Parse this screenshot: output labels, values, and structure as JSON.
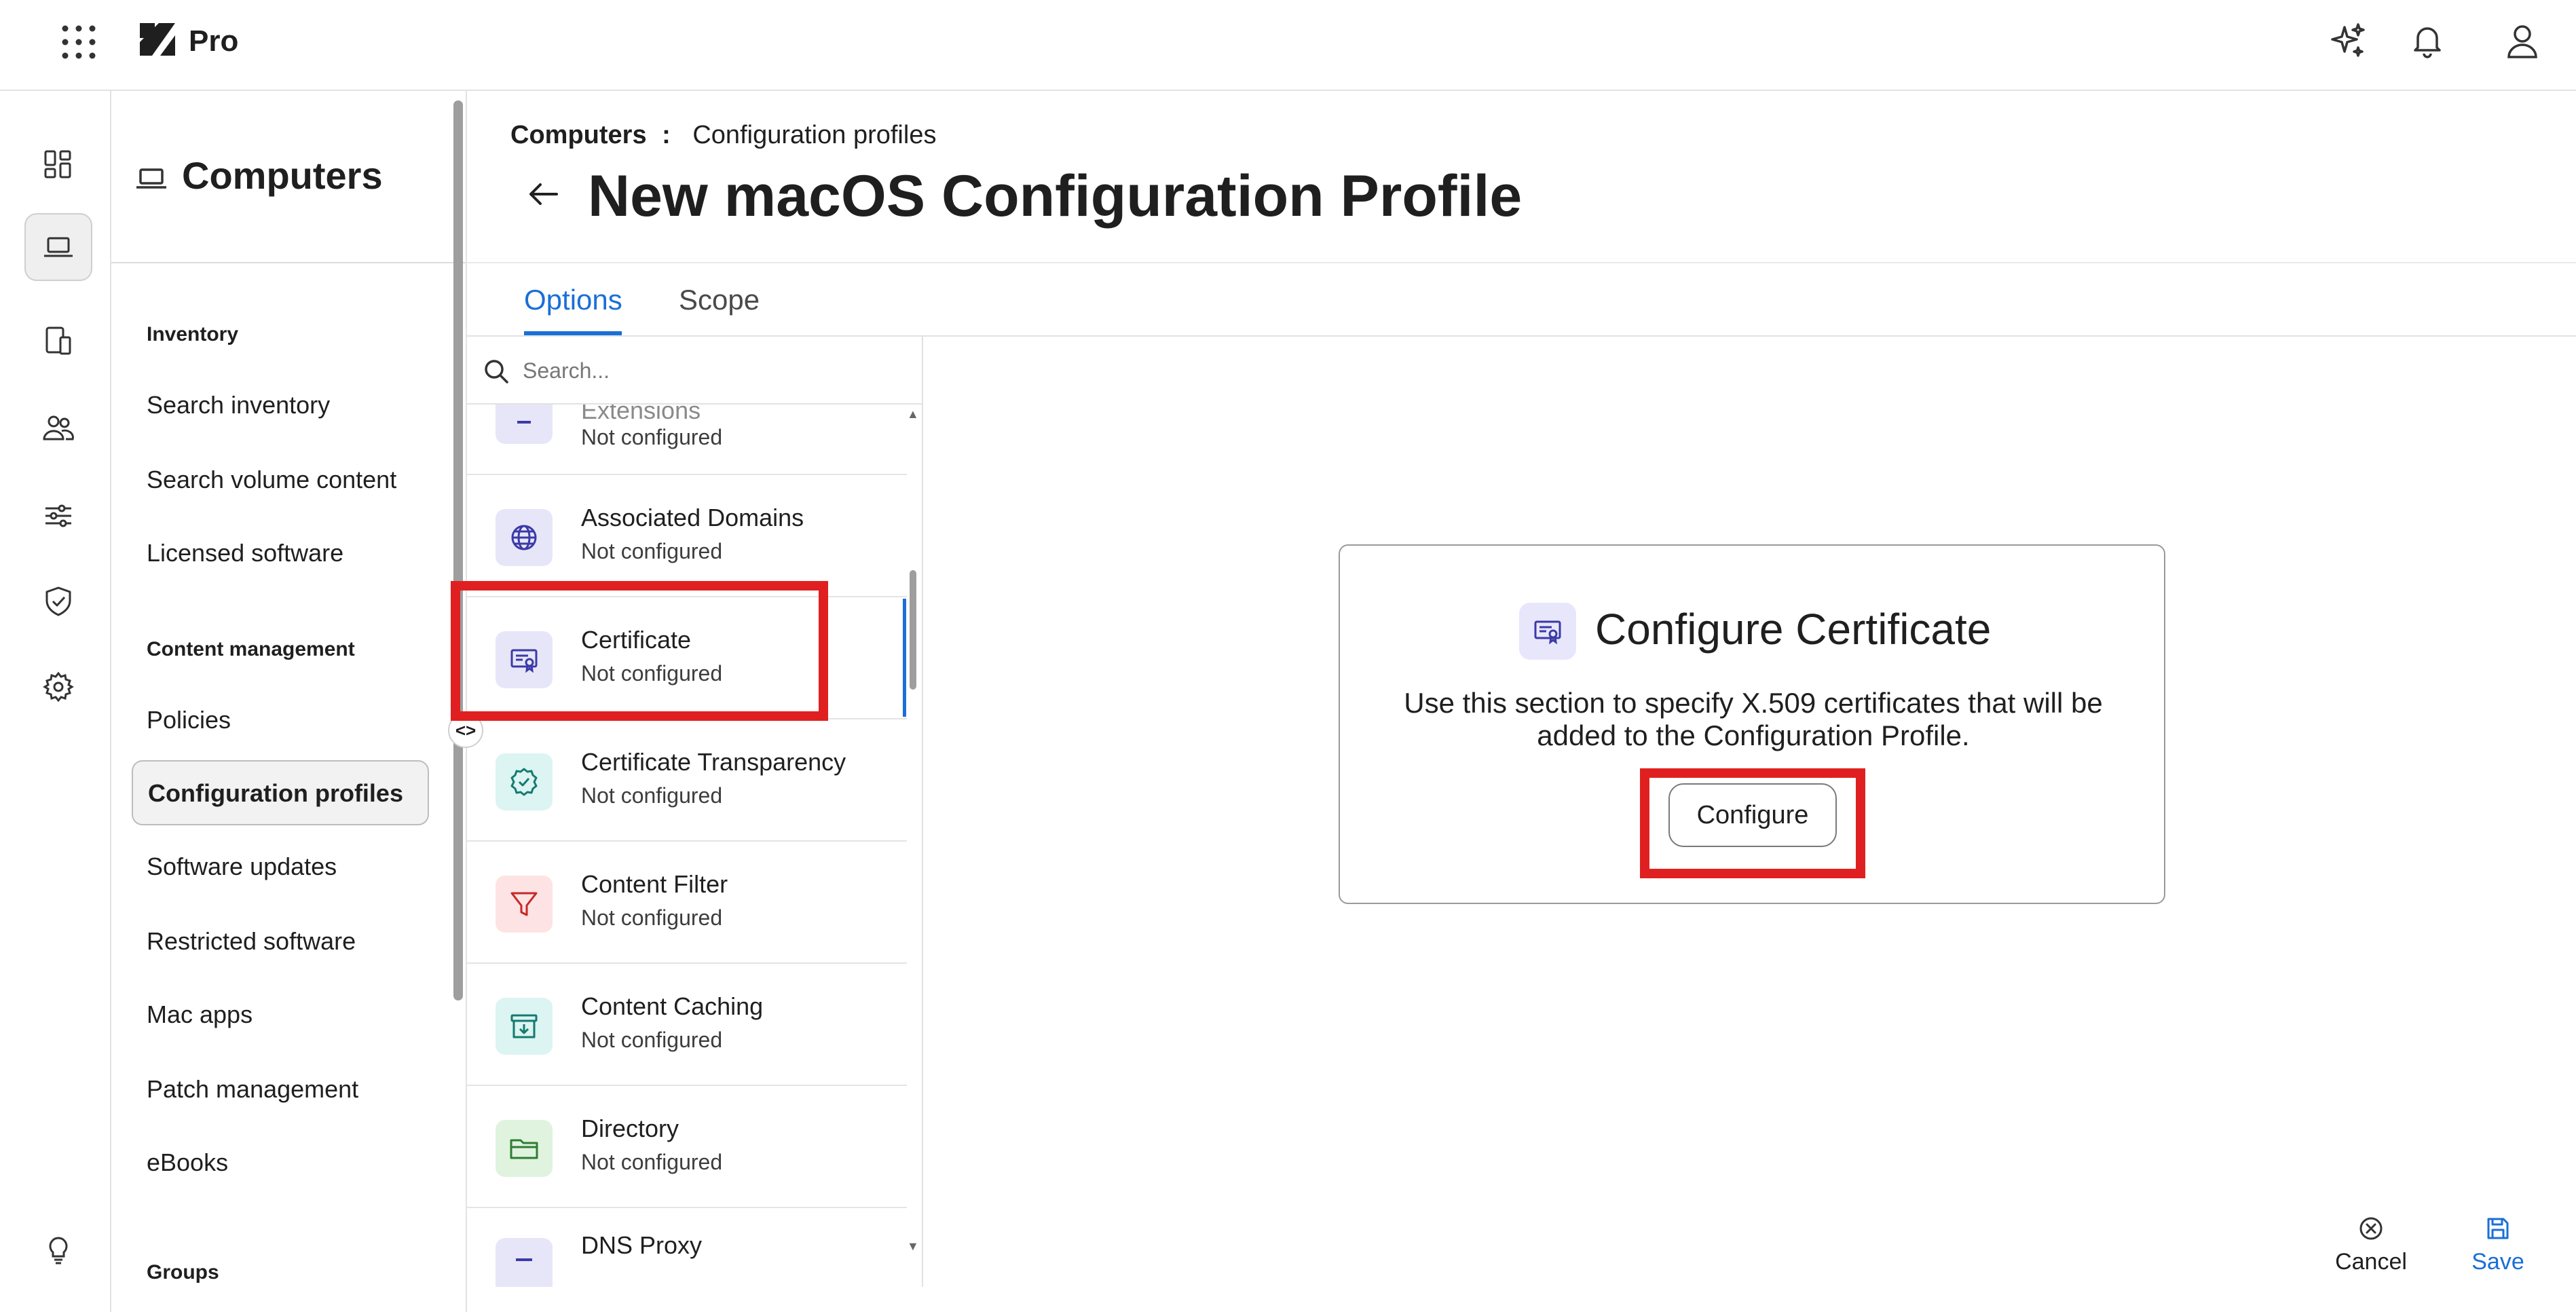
{
  "app": {
    "brand": "Pro"
  },
  "colors": {
    "accent": "#1a6fd6",
    "highlight": "#e02020",
    "page_bg": "#ffffff"
  },
  "topbar": {
    "icons": [
      "apps-grid-icon",
      "logo-icon",
      "sparkle-icon",
      "bell-icon",
      "user-icon"
    ]
  },
  "rail": {
    "icons": [
      "dashboard-icon",
      "laptop-icon",
      "devices-icon",
      "users-icon",
      "sliders-icon",
      "shield-check-icon",
      "gear-icon",
      "lightbulb-icon"
    ],
    "active": "laptop-icon"
  },
  "subnav": {
    "title": "Computers",
    "sections": [
      {
        "label": "Inventory",
        "items": [
          "Search inventory",
          "Search volume content",
          "Licensed software"
        ]
      },
      {
        "label": "Content management",
        "items": [
          "Policies",
          "Configuration profiles",
          "Software updates",
          "Restricted software",
          "Mac apps",
          "Patch management",
          "eBooks"
        ]
      },
      {
        "label": "Groups",
        "items": []
      }
    ],
    "active_item": "Configuration profiles",
    "collapse_label": "<>"
  },
  "header": {
    "breadcrumb_root": "Computers",
    "breadcrumb_sep": ":",
    "breadcrumb_current": "Configuration profiles",
    "title": "New macOS Configuration Profile"
  },
  "tabs": [
    {
      "label": "Options",
      "active": true
    },
    {
      "label": "Scope",
      "active": false
    }
  ],
  "payloads": {
    "search_placeholder": "Search...",
    "items": [
      {
        "name": "Extensions",
        "status": "Not configured",
        "icon": "extensions-icon"
      },
      {
        "name": "Associated Domains",
        "status": "Not configured",
        "icon": "globe-icon"
      },
      {
        "name": "Certificate",
        "status": "Not configured",
        "icon": "certificate-icon",
        "selected": true
      },
      {
        "name": "Certificate Transparency",
        "status": "Not configured",
        "icon": "badge-check-icon"
      },
      {
        "name": "Content Filter",
        "status": "Not configured",
        "icon": "funnel-icon"
      },
      {
        "name": "Content Caching",
        "status": "Not configured",
        "icon": "archive-download-icon"
      },
      {
        "name": "Directory",
        "status": "Not configured",
        "icon": "folder-icon"
      },
      {
        "name": "DNS Proxy",
        "status": "",
        "icon": "dns-proxy-icon"
      }
    ]
  },
  "panel": {
    "title": "Configure Certificate",
    "description": "Use this section to specify X.509 certificates that will be added to the Configuration Profile.",
    "button": "Configure"
  },
  "footer": {
    "cancel": "Cancel",
    "save": "Save"
  }
}
